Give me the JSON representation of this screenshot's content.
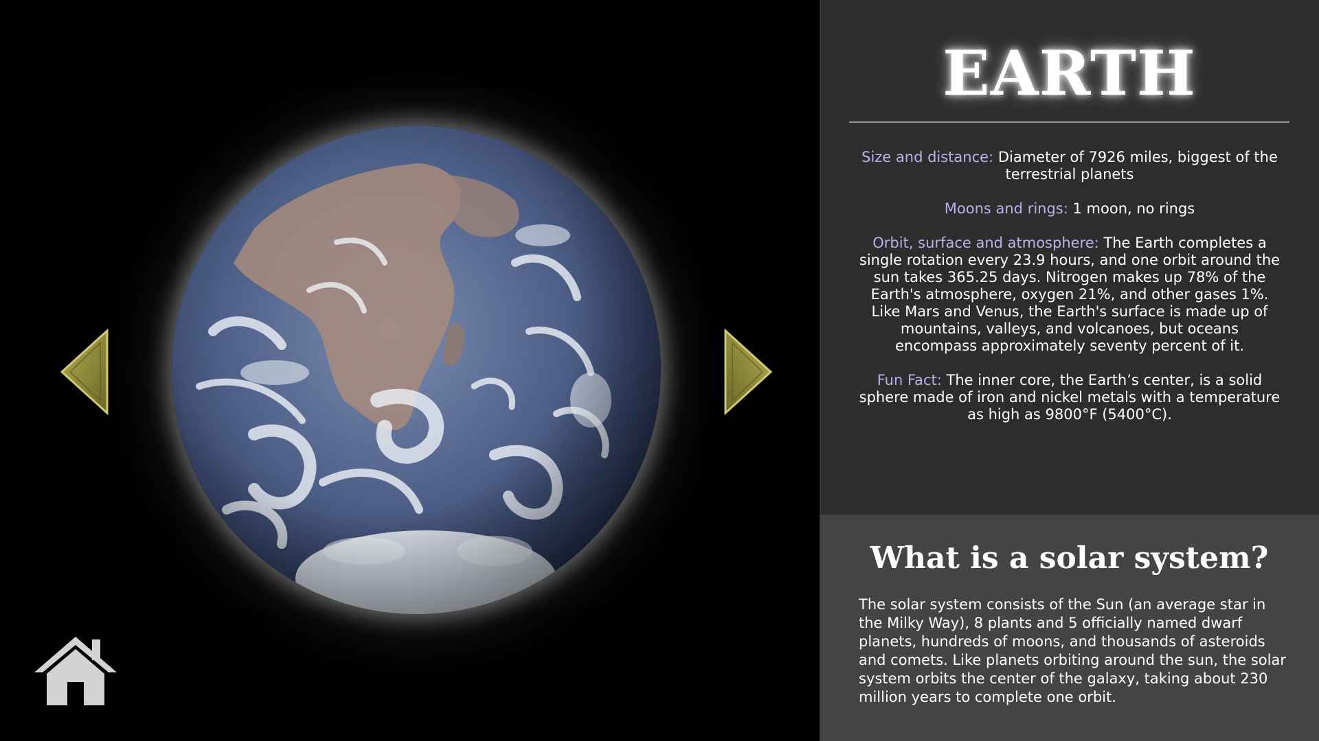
{
  "planet": {
    "title": "EARTH",
    "image_icon": "earth-globe-image"
  },
  "facts": [
    {
      "label": "Size and distance:",
      "text": " Diameter of 7926 miles, biggest of the terrestrial planets"
    },
    {
      "label": "Moons and rings:",
      "text": " 1 moon, no rings"
    },
    {
      "label": "Orbit, surface and atmosphere:",
      "text": " The Earth completes a single rotation every 23.9 hours, and one orbit around the sun takes 365.25 days. Nitrogen makes up 78% of the Earth's atmosphere, oxygen 21%, and other gases 1%. Like Mars and Venus, the Earth's surface is made up of mountains, valleys, and volcanoes, but oceans encompass approximately seventy percent of it."
    },
    {
      "label": "Fun Fact:",
      "text": " The inner core, the Earth’s center, is a solid sphere made of iron and nickel metals with a temperature as high as 9800°F (5400°C)."
    }
  ],
  "solar": {
    "title": "What is a solar system?",
    "text": "The solar system consists of the Sun (an average star in the Milky Way), 8 plants and 5 officially named dwarf planets, hundreds of moons, and thousands of asteroids and comets. Like planets orbiting around the sun, the solar system orbits the center of the galaxy, taking about 230 million years to complete one orbit."
  },
  "navigation": {
    "prev_icon": "triangle-left-icon",
    "next_icon": "triangle-right-icon",
    "home_icon": "home-icon"
  },
  "colors": {
    "viewport_bg": "#000000",
    "info_panel_bg": "#2d2d2d",
    "solar_panel_bg": "#444444",
    "fact_label": "#b4b4ea",
    "arrow_gold": "#8f8a3a"
  }
}
